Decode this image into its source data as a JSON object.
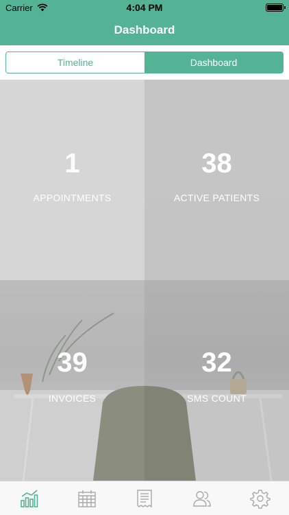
{
  "status_bar": {
    "carrier": "Carrier",
    "time": "4:04 PM"
  },
  "nav": {
    "title": "Dashboard"
  },
  "segments": [
    {
      "label": "Timeline",
      "selected": false
    },
    {
      "label": "Dashboard",
      "selected": true
    }
  ],
  "stats": [
    {
      "value": "1",
      "label": "APPOINTMENTS"
    },
    {
      "value": "38",
      "label": "ACTIVE PATIENTS"
    },
    {
      "value": "39",
      "label": "INVOICES"
    },
    {
      "value": "32",
      "label": "SMS COUNT"
    }
  ],
  "tab_bar": {
    "items": [
      {
        "icon": "chart-icon",
        "selected": true
      },
      {
        "icon": "calendar-icon",
        "selected": false
      },
      {
        "icon": "receipt-icon",
        "selected": false
      },
      {
        "icon": "patients-icon",
        "selected": false
      },
      {
        "icon": "settings-icon",
        "selected": false
      }
    ]
  },
  "colors": {
    "accent": "#53b394",
    "tab_inactive": "#a8a8a8",
    "tab_bar_bg": "#f8f8f8"
  }
}
